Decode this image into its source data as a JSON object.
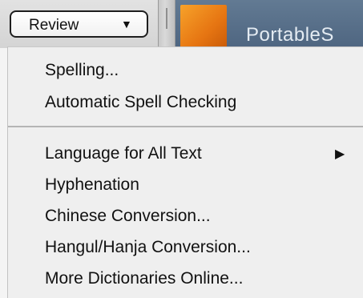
{
  "toolbar": {
    "popup_label": "Review",
    "popup_arrow_icon": "chevron-down-icon",
    "doc_title": "PortableS",
    "doc_thumb_color": "#e67512",
    "doc_bg_color": "#566e88"
  },
  "menu": {
    "group1": [
      {
        "label": "Spelling..."
      },
      {
        "label": "Automatic Spell Checking"
      }
    ],
    "group2": [
      {
        "label": "Language for All Text",
        "submenu_icon": "submenu-arrow-icon"
      },
      {
        "label": "Hyphenation"
      },
      {
        "label": "Chinese Conversion..."
      },
      {
        "label": "Hangul/Hanja Conversion..."
      },
      {
        "label": "More Dictionaries Online..."
      }
    ]
  }
}
